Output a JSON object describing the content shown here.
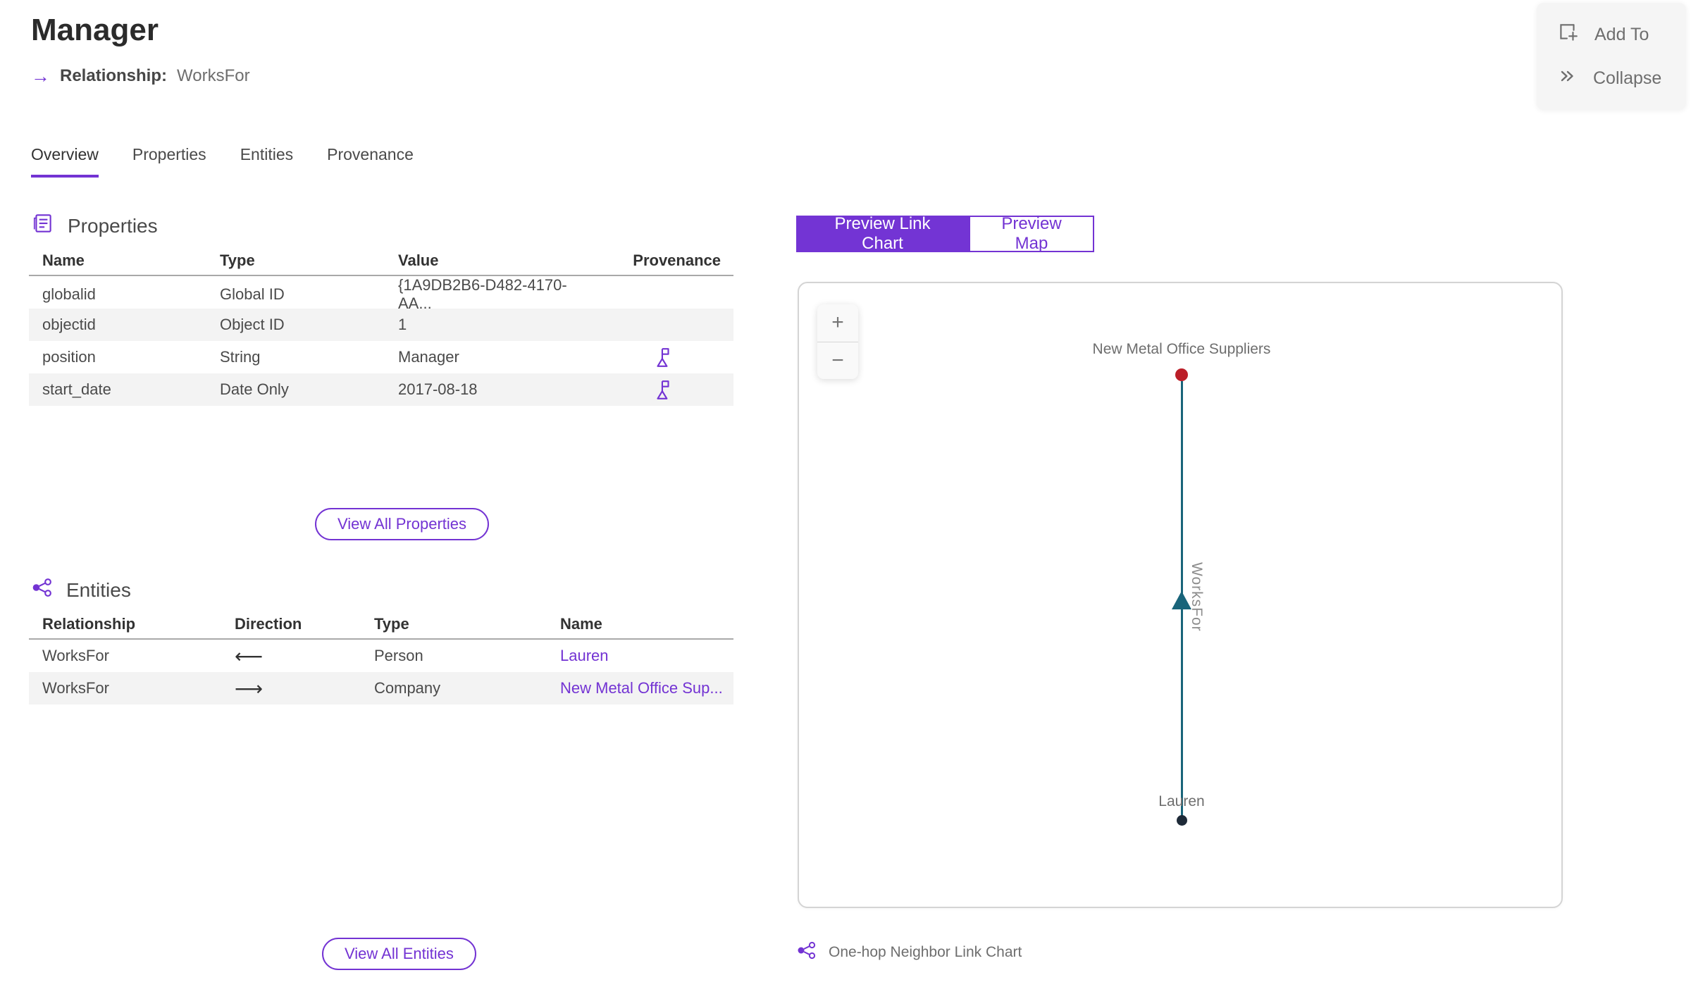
{
  "header": {
    "title": "Manager",
    "relationship_arrow": "→",
    "relationship_label": "Relationship:",
    "relationship_value": "WorksFor"
  },
  "actions": {
    "add_to_label": "Add To",
    "collapse_label": "Collapse"
  },
  "tabs": [
    {
      "label": "Overview",
      "active": true
    },
    {
      "label": "Properties",
      "active": false
    },
    {
      "label": "Entities",
      "active": false
    },
    {
      "label": "Provenance",
      "active": false
    }
  ],
  "properties_section": {
    "title": "Properties",
    "columns": [
      "Name",
      "Type",
      "Value",
      "Provenance"
    ],
    "rows": [
      {
        "name": "globalid",
        "type": "Global ID",
        "value": "{1A9DB2B6-D482-4170-AA...",
        "has_provenance": false
      },
      {
        "name": "objectid",
        "type": "Object ID",
        "value": "1",
        "has_provenance": false
      },
      {
        "name": "position",
        "type": "String",
        "value": "Manager",
        "has_provenance": true
      },
      {
        "name": "start_date",
        "type": "Date Only",
        "value": "2017-08-18",
        "has_provenance": true
      }
    ],
    "view_all_label": "View All Properties"
  },
  "entities_section": {
    "title": "Entities",
    "columns": [
      "Relationship",
      "Direction",
      "Type",
      "Name"
    ],
    "rows": [
      {
        "relationship": "WorksFor",
        "direction": "⟵",
        "type": "Person",
        "name": "Lauren"
      },
      {
        "relationship": "WorksFor",
        "direction": "⟶",
        "type": "Company",
        "name": "New Metal Office Sup..."
      }
    ],
    "view_all_label": "View All Entities"
  },
  "preview": {
    "link_chart_label": "Preview Link Chart",
    "map_label": "Preview Map",
    "zoom_in_label": "+",
    "zoom_out_label": "−",
    "caption": "One-hop Neighbor Link Chart"
  },
  "chart_data": {
    "type": "link-chart",
    "nodes": [
      {
        "label": "New Metal Office Suppliers",
        "entity_type": "Company",
        "color": "#bb1e28",
        "position": "top"
      },
      {
        "label": "Lauren",
        "entity_type": "Person",
        "color": "#1e2a38",
        "position": "bottom"
      }
    ],
    "edges": [
      {
        "label": "WorksFor",
        "from": "Lauren",
        "to": "New Metal Office Suppliers",
        "direction": "up",
        "color": "#19647a"
      }
    ]
  },
  "icons": {
    "add_to": "add-to-icon",
    "collapse": "double-chevron-right-icon",
    "properties": "properties-document-icon",
    "entities": "link-nodes-icon",
    "provenance": "flag-icon",
    "one_hop": "link-nodes-icon",
    "zoom_in": "plus-icon",
    "zoom_out": "minus-icon"
  },
  "colors": {
    "accent": "#7333d3",
    "link": "#7333d3",
    "node_company": "#bb1e28",
    "node_person": "#1e2a38",
    "edge": "#19647a",
    "row_stripe": "#f3f3f3",
    "muted_text": "#6e6e6e"
  }
}
